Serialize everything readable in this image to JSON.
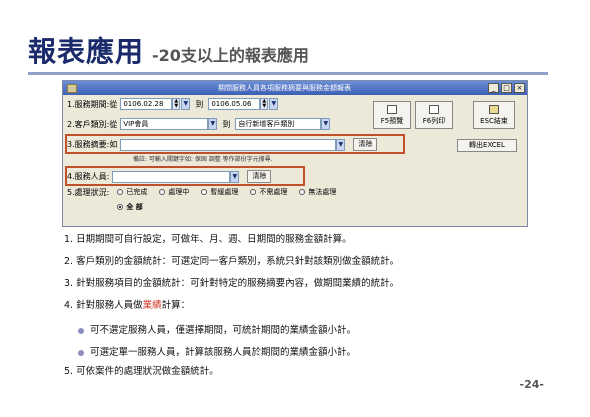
{
  "slide": {
    "title": "報表應用",
    "subtitle": "-20支以上的報表應用",
    "page_number": "-24-"
  },
  "window": {
    "title": "期間服務人員各項服務摘要與服務金額報表",
    "row1": {
      "label": "1.服務期間:從",
      "from": "0106.02.28",
      "to_label": "到",
      "to": "0106.05.06"
    },
    "row2": {
      "label": "2.客戶類別:從",
      "from": "VIP會員",
      "to_label": "到",
      "to": "自行新增客戶類別"
    },
    "row3": {
      "label": "3.服務摘要:如",
      "value": "",
      "clear": "清除"
    },
    "hint": "備註: 可輸入關鍵字如: 保固 調整 等作部份字元搜尋.",
    "row4": {
      "label": "4.服務人員:",
      "value": "",
      "clear": "清除"
    },
    "row5": {
      "label": "5.處理狀況:",
      "options": [
        "已完成",
        "處理中",
        "暫緩處理",
        "不需處理",
        "無法處理",
        "全 部"
      ],
      "selected": "全 部"
    },
    "buttons": {
      "preview": "F5預覽",
      "print": "F6列印",
      "close": "ESC結束",
      "excel": "轉出EXCEL"
    }
  },
  "bullets": {
    "b1": "1. 日期期間可自行設定，可做年、月、週、日期間的服務金額計算。",
    "b2": "2. 客戶類別的金額統計：可選定同一客戶類別，系統只針對該類別做金額統計。",
    "b3": "3. 針對服務項目的金額統計：可針對特定的服務摘要內容，做期間業績的統計。",
    "b4_pre": "4. 針對服務人員做",
    "b4_red": "業績",
    "b4_post": "計算：",
    "s1": "可不選定服務人員，僅選擇期間，可統計期間的業績金額小計。",
    "s2": "可選定單一服務人員，計算該服務人員於期間的業績金額小計。",
    "b5": "5. 可依案件的處理狀況做金額統計。"
  }
}
